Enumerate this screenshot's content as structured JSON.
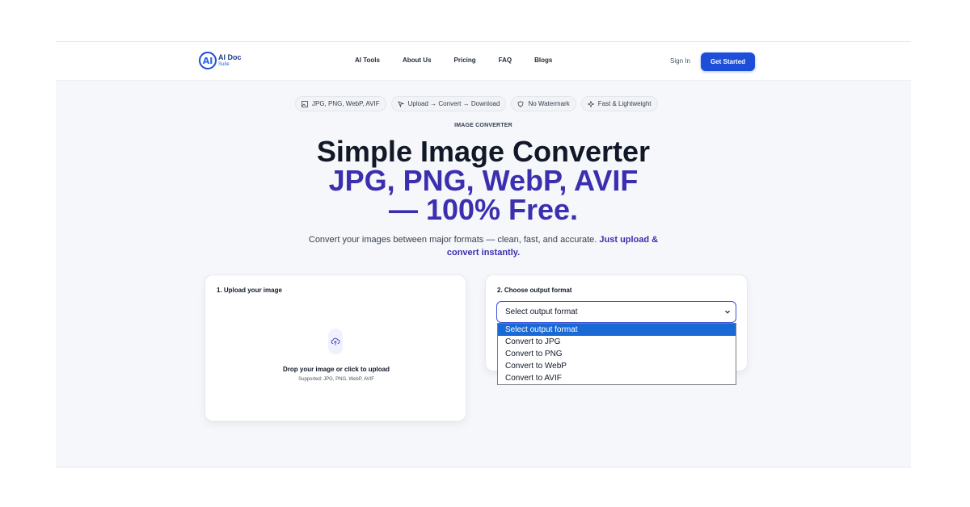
{
  "brand": {
    "name_line1": "AI Doc",
    "name_line2": "Suite",
    "mark": "AI"
  },
  "nav": {
    "links": [
      "AI Tools",
      "About Us",
      "Pricing",
      "FAQ",
      "Blogs"
    ],
    "sign_in": "Sign In",
    "cta": "Get Started"
  },
  "pills": [
    {
      "icon": "image-icon",
      "label": "JPG, PNG, WebP, AVIF"
    },
    {
      "icon": "cursor-icon",
      "label": "Upload → Convert → Download"
    },
    {
      "icon": "shield-icon",
      "label": "No Watermark"
    },
    {
      "icon": "sparkle-icon",
      "label": "Fast & Lightweight"
    }
  ],
  "eyebrow": "IMAGE CONVERTER",
  "hero": {
    "line1": "Simple Image Converter",
    "line2": "JPG, PNG, WebP, AVIF",
    "line3": "— 100% Free."
  },
  "subtitle": {
    "text": "Convert your images between major formats — clean, fast, and accurate.",
    "highlight": "Just upload & convert instantly."
  },
  "upload": {
    "label": "1. Upload your image",
    "drop_title": "Drop your image or click to upload",
    "supported": "Supported: JPG, PNG, WebP, AVIF"
  },
  "format": {
    "label": "2. Choose output format",
    "selected": "Select output format",
    "options": [
      "Select output format",
      "Convert to JPG",
      "Convert to PNG",
      "Convert to WebP",
      "Convert to AVIF"
    ]
  },
  "colors": {
    "accent": "#1d4ed8",
    "hero_highlight": "#3b2fb0",
    "dropdown_selection": "#1a6ad6",
    "page_bg": "#f5f7fa"
  }
}
